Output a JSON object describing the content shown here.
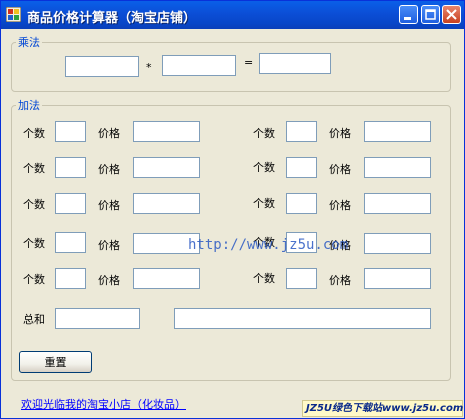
{
  "window": {
    "title": "商品价格计算器（淘宝店铺）"
  },
  "multiply": {
    "legend": "乘法",
    "operator": "*",
    "equals": "=",
    "a": "",
    "b": "",
    "result": ""
  },
  "add": {
    "legend": "加法",
    "count_label": "个数",
    "price_label": "价格",
    "total_label": "总和",
    "total_value": "",
    "total_detail": ""
  },
  "reset_button": "重置",
  "footer_link": "欢迎光临我的淘宝小店（化妆品）",
  "watermark": "http://www.jz5u.com",
  "badge": "JZ5U绿色下载站www.jz5u.com"
}
